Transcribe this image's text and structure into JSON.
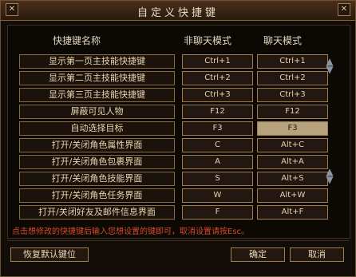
{
  "title": "自定义快捷键",
  "headers": {
    "name": "快捷键名称",
    "normal": "非聊天模式",
    "chat": "聊天模式"
  },
  "rows": [
    {
      "label": "显示第一页主技能快捷键",
      "normal": "Ctrl+1",
      "chat": "Ctrl+1"
    },
    {
      "label": "显示第二页主技能快捷键",
      "normal": "Ctrl+2",
      "chat": "Ctrl+2"
    },
    {
      "label": "显示第三页主技能快捷键",
      "normal": "Ctrl+3",
      "chat": "Ctrl+3"
    },
    {
      "label": "屏蔽可见人物",
      "normal": "F12",
      "chat": "F12"
    },
    {
      "label": "自动选择目标",
      "normal": "F3",
      "chat": "F3"
    },
    {
      "label": "打开/关闭角色属性界面",
      "normal": "C",
      "chat": "Alt+C"
    },
    {
      "label": "打开/关闭角色包裹界面",
      "normal": "A",
      "chat": "Alt+A"
    },
    {
      "label": "打开/关闭角色技能界面",
      "normal": "S",
      "chat": "Alt+S"
    },
    {
      "label": "打开/关闭角色任务界面",
      "normal": "W",
      "chat": "Alt+W"
    },
    {
      "label": "打开/关闭好友及邮件信息界面",
      "normal": "F",
      "chat": "Alt+F"
    }
  ],
  "hint": "点击想修改的快捷键后输入您想设置的键即可，取消设置请按Esc。",
  "buttons": {
    "reset": "恢复默认键位",
    "ok": "确定",
    "cancel": "取消"
  },
  "icons": {
    "close_left": "x-icon",
    "close_right": "x-icon"
  }
}
